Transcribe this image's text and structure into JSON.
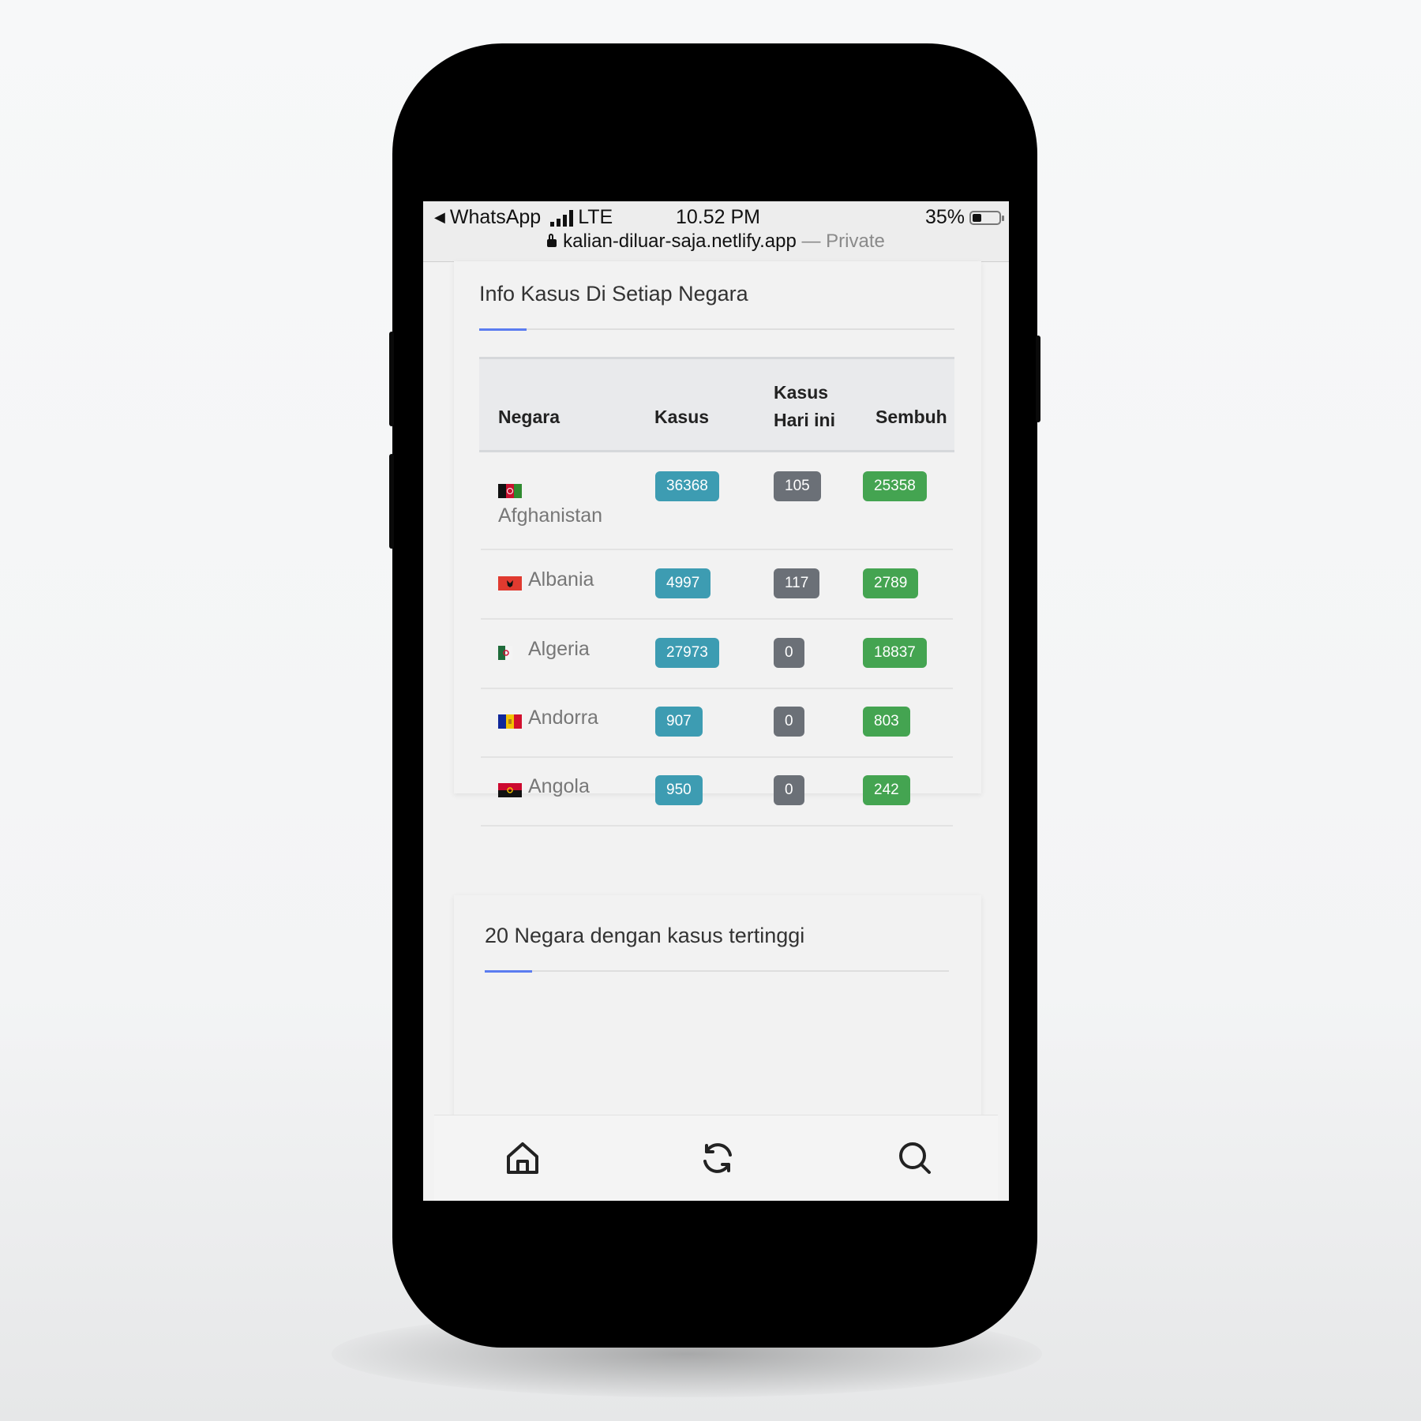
{
  "status_bar": {
    "back_app": "WhatsApp",
    "network": "LTE",
    "time": "10.52 PM",
    "battery": "35%",
    "battery_level": 0.35
  },
  "url_bar": {
    "domain": "kalian-diluar-saja.netlify.app",
    "mode": "— Private"
  },
  "country_card": {
    "title": "Info Kasus Di Setiap Negara",
    "columns": {
      "country": "Negara",
      "cases": "Kasus",
      "today_line1": "Kasus",
      "today_line2": "Hari ini",
      "recovered": "Sembuh"
    },
    "rows": [
      {
        "country": "Afghanistan",
        "flag": "afghanistan-flag-icon",
        "cases": "36368",
        "today": "105",
        "recovered": "25358"
      },
      {
        "country": "Albania",
        "flag": "albania-flag-icon",
        "cases": "4997",
        "today": "117",
        "recovered": "2789"
      },
      {
        "country": "Algeria",
        "flag": "algeria-flag-icon",
        "cases": "27973",
        "today": "0",
        "recovered": "18837"
      },
      {
        "country": "Andorra",
        "flag": "andorra-flag-icon",
        "cases": "907",
        "today": "0",
        "recovered": "803"
      },
      {
        "country": "Angola",
        "flag": "angola-flag-icon",
        "cases": "950",
        "today": "0",
        "recovered": "242"
      }
    ]
  },
  "top20_card": {
    "title": "20 Negara dengan kasus tertinggi"
  },
  "bottom_nav": [
    "home-icon",
    "refresh-icon",
    "search-icon"
  ],
  "colors": {
    "cases_badge": "#3d9cb2",
    "today_badge": "#6b7077",
    "recovered_badge": "#44a451",
    "accent": "#5b7cf0"
  }
}
